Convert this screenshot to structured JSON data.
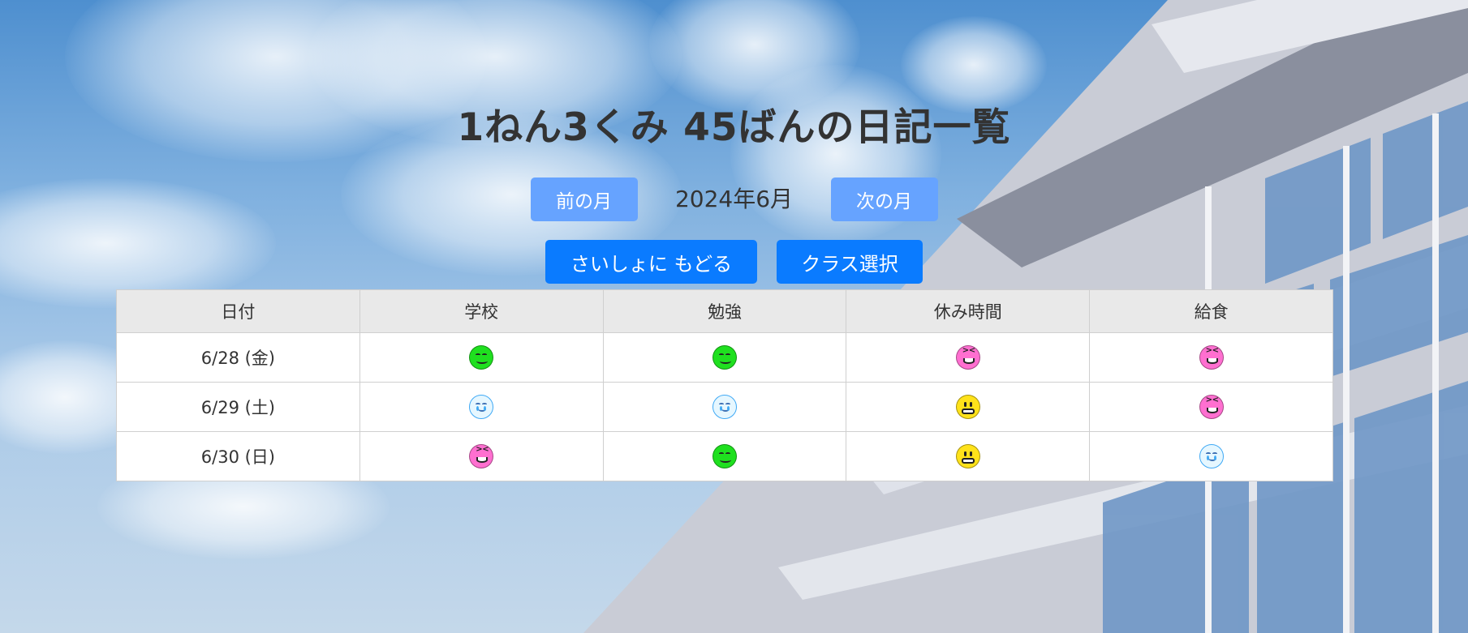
{
  "page": {
    "title": "1ねん3くみ 45ばんの日記一覧"
  },
  "month_nav": {
    "prev_label": "前の月",
    "current_month": "2024年6月",
    "next_label": "次の月"
  },
  "actions": {
    "home_label": "さいしょに もどる",
    "class_select_label": "クラス選択"
  },
  "colors": {
    "primary_button": "#0a7bff",
    "light_button": "#66a3ff",
    "header_bg": "#e9e9e9"
  },
  "table": {
    "headers": [
      "日付",
      "学校",
      "勉強",
      "休み時間",
      "給食"
    ],
    "rows": [
      {
        "date": "6/28 (金)",
        "school": "happy",
        "study": "happy",
        "break": "laugh",
        "lunch": "laugh"
      },
      {
        "date": "6/29 (土)",
        "school": "cry",
        "study": "cry",
        "break": "grin",
        "lunch": "laugh"
      },
      {
        "date": "6/30 (日)",
        "school": "laugh",
        "study": "happy",
        "break": "grin",
        "lunch": "cry"
      }
    ]
  },
  "icons": {
    "happy": "happy-face-icon",
    "laugh": "laughing-face-icon",
    "cry": "crying-face-icon",
    "grin": "grimacing-face-icon"
  }
}
